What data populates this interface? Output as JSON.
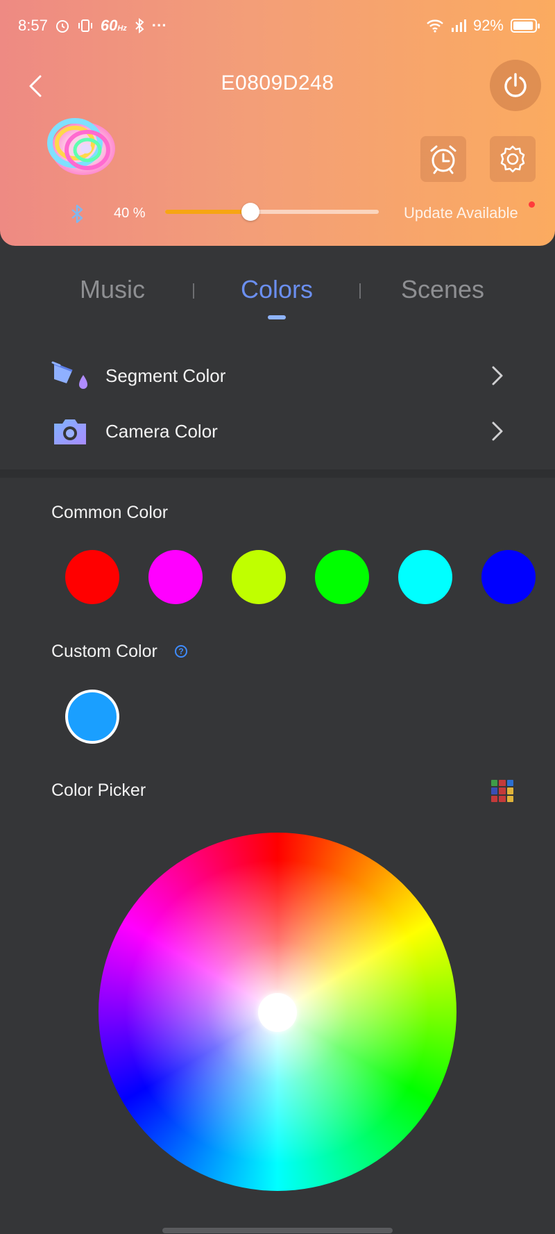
{
  "status_bar": {
    "time": "8:57",
    "refresh_rate": "60",
    "refresh_unit": "Hz",
    "more": "···",
    "battery": "92%"
  },
  "header": {
    "title": "E0809D248",
    "brightness_label": "40 %",
    "brightness_value": 40,
    "update_label": "Update Available",
    "update_dot_color": "#ff3b3b",
    "gradient_colors": [
      "#ee8a83",
      "#fbab60"
    ]
  },
  "tabs": [
    {
      "label": "Music",
      "active": false
    },
    {
      "label": "Colors",
      "active": true
    },
    {
      "label": "Scenes",
      "active": false
    }
  ],
  "features": {
    "segment": {
      "label": "Segment Color",
      "icon": "paint-bucket-icon"
    },
    "camera": {
      "label": "Camera Color",
      "icon": "camera-icon"
    }
  },
  "common_color": {
    "title": "Common Color",
    "swatches": [
      "#ff0000",
      "#ff00ff",
      "#c0ff00",
      "#00ff00",
      "#00ffff",
      "#0000ff"
    ]
  },
  "custom_color": {
    "title": "Custom Color",
    "help": "?",
    "swatch": "#1a9fff"
  },
  "color_picker": {
    "title": "Color Picker",
    "palette_colors": [
      "#3f9c48",
      "#c43a3a",
      "#2c6fd0",
      "#3a4fb5",
      "#c43a3a",
      "#e0b33a",
      "#c43a3a",
      "#c43a3a",
      "#e0b33a"
    ]
  },
  "colors": {
    "accent_tab": "#6b8ff0",
    "slider_fill": "#f7a513",
    "background": "#353638"
  }
}
